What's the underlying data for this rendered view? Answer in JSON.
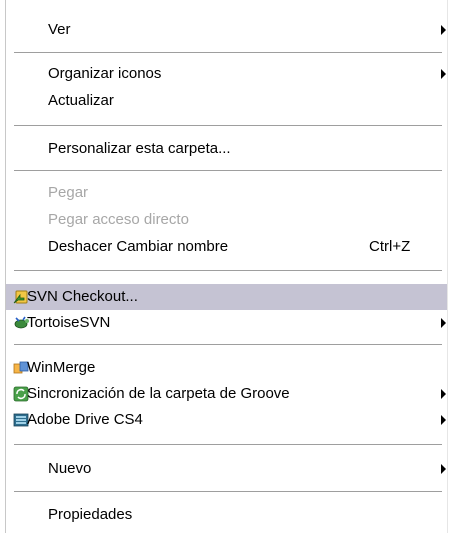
{
  "menu": {
    "items": [
      {
        "label": "Ver",
        "submenu": true
      },
      {
        "label": "Organizar iconos",
        "submenu": true
      },
      {
        "label": "Actualizar"
      },
      {
        "label": "Personalizar esta carpeta..."
      },
      {
        "label": "Pegar",
        "disabled": true
      },
      {
        "label": "Pegar acceso directo",
        "disabled": true
      },
      {
        "label": "Deshacer Cambiar nombre",
        "shortcut": "Ctrl+Z"
      },
      {
        "label": "SVN Checkout...",
        "icon": "svn-checkout-icon",
        "highlighted": true
      },
      {
        "label": "TortoiseSVN",
        "icon": "tortoisesvn-icon",
        "submenu": true
      },
      {
        "label": "WinMerge",
        "icon": "winmerge-icon"
      },
      {
        "label": "Sincronización de la carpeta de Groove",
        "icon": "groove-sync-icon",
        "submenu": true
      },
      {
        "label": "Adobe Drive CS4",
        "icon": "adobe-drive-icon",
        "submenu": true
      },
      {
        "label": "Nuevo",
        "submenu": true
      },
      {
        "label": "Propiedades"
      }
    ]
  },
  "colors": {
    "highlight": "#c5c3d3",
    "disabled_text": "#a7a7a7",
    "separator": "#9e9e9e"
  }
}
